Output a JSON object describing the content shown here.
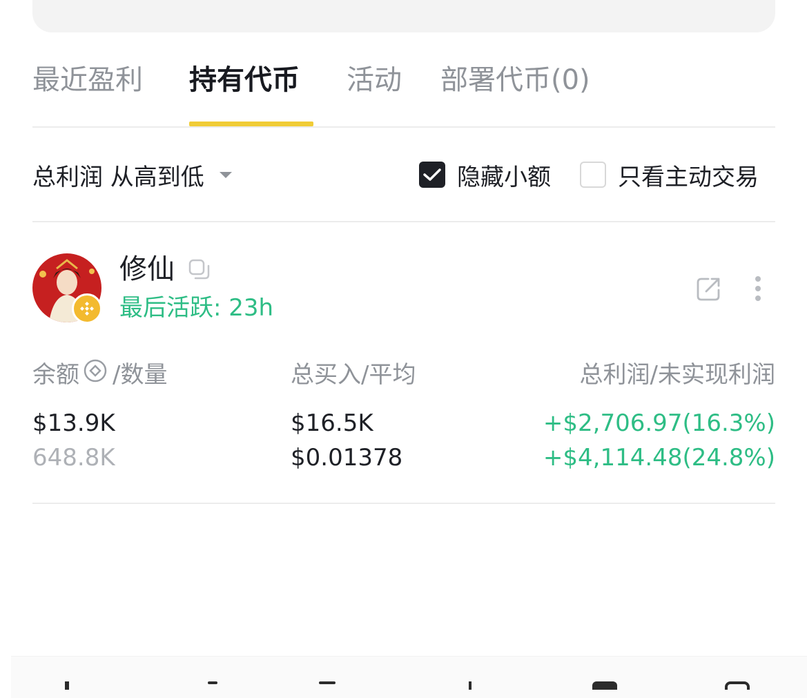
{
  "tabs": [
    {
      "label": "最近盈利",
      "active": false
    },
    {
      "label": "持有代币",
      "active": true
    },
    {
      "label": "活动",
      "active": false
    },
    {
      "label": "部署代币(0)",
      "active": false
    }
  ],
  "filters": {
    "sort_label": "总利润 从高到低",
    "hide_small": {
      "label": "隐藏小额",
      "checked": true
    },
    "active_only": {
      "label": "只看主动交易",
      "checked": false
    }
  },
  "token": {
    "name": "修仙",
    "last_active": "最后活跃: 23h",
    "chain_icon": "bnb-chain-icon",
    "columns": {
      "balance_header": "余额",
      "balance_header_suffix": "/数量",
      "bought_header": "总买入/平均",
      "pnl_header": "总利润/未实现利润"
    },
    "balance": "$13.9K",
    "quantity": "648.8K",
    "total_bought": "$16.5K",
    "avg_price": "$0.01378",
    "total_profit": "+$2,706.97(16.3%)",
    "unrealized_profit": "+$4,114.48(24.8%)"
  },
  "colors": {
    "accent_yellow": "#f0cc37",
    "profit_green": "#2ebd85",
    "muted_text": "#8f9399"
  }
}
